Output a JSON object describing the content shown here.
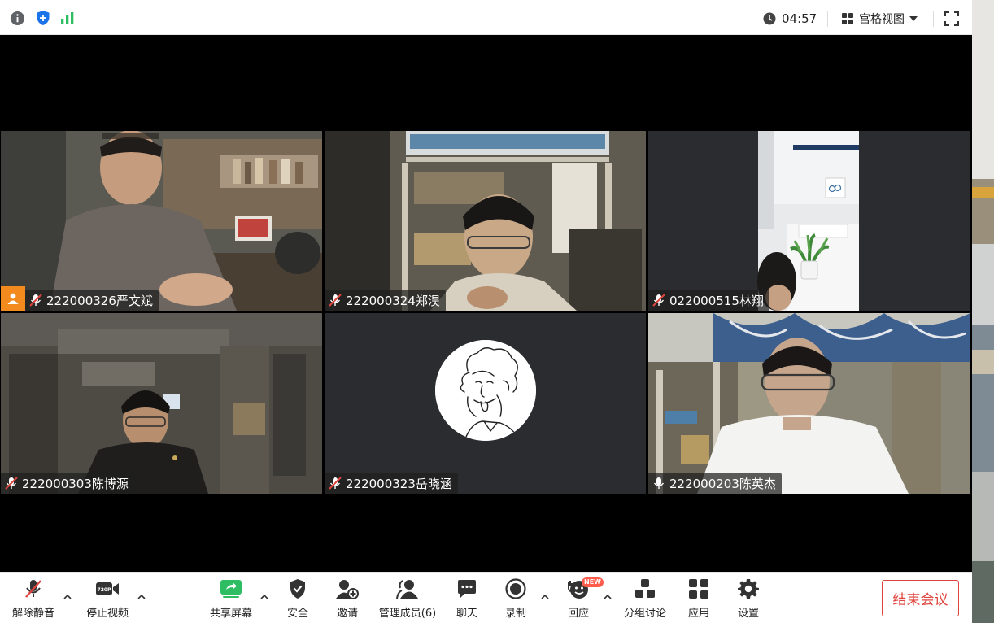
{
  "topbar": {
    "timer": "04:57",
    "view_mode_label": "宫格视图"
  },
  "participants": [
    {
      "name": "222000326严文斌",
      "muted": true,
      "host": true
    },
    {
      "name": "222000324郑淏",
      "muted": true,
      "host": false
    },
    {
      "name": "022000515林翔",
      "muted": true,
      "host": false
    },
    {
      "name": "222000303陈博源",
      "muted": true,
      "host": false
    },
    {
      "name": "222000323岳晓涵",
      "muted": true,
      "host": false
    },
    {
      "name": "222000203陈英杰",
      "muted": false,
      "host": false
    }
  ],
  "toolbar": {
    "unmute": "解除静音",
    "stop_video": "停止视频",
    "video_badge": "720P",
    "share_screen": "共享屏幕",
    "security": "安全",
    "invite": "邀请",
    "manage_members": "管理成员(6)",
    "chat": "聊天",
    "record": "录制",
    "reactions": "回应",
    "reactions_badge": "NEW",
    "breakout": "分组讨论",
    "apps": "应用",
    "settings": "设置",
    "end_meeting": "结束会议"
  },
  "colors": {
    "accent_green": "#2dbd63",
    "end_red": "#e0443e",
    "host_orange": "#f28a1e",
    "shield_blue": "#1a73e8"
  },
  "icons": [
    "info-icon",
    "shield-icon",
    "signal-icon",
    "clock-icon",
    "grid-view-icon",
    "fullscreen-icon",
    "mic-muted-icon",
    "mic-icon",
    "camera-icon",
    "share-screen-icon",
    "shield-check-icon",
    "add-person-icon",
    "members-icon",
    "chat-icon",
    "record-icon",
    "reaction-icon",
    "breakout-icon",
    "apps-icon",
    "gear-icon"
  ]
}
